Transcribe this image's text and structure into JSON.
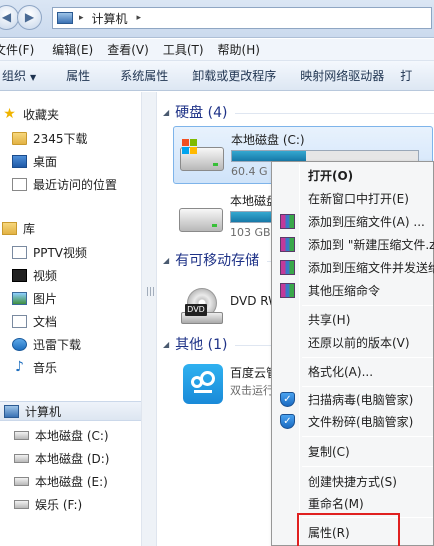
{
  "address": {
    "breadcrumb": "计算机",
    "separator": "▸"
  },
  "menu": [
    "文件(F)",
    "编辑(E)",
    "查看(V)",
    "工具(T)",
    "帮助(H)"
  ],
  "toolbar": {
    "organize": "组织",
    "items": [
      "属性",
      "系统属性",
      "卸载或更改程序",
      "映射网络驱动器",
      "打"
    ]
  },
  "nav": {
    "favorites": "收藏夹",
    "fav_items": [
      "2345下载",
      "桌面",
      "最近访问的位置"
    ],
    "libraries": "库",
    "lib_items": [
      "PPTV视频",
      "视频",
      "图片",
      "文档",
      "迅雷下载",
      "音乐"
    ],
    "computer": "计算机",
    "drives": [
      "本地磁盘 (C:)",
      "本地磁盘 (D:)",
      "本地磁盘 (E:)",
      "娱乐 (F:)"
    ]
  },
  "content": {
    "group_hdd": "硬盘 (4)",
    "group_removable": "有可移动存储",
    "group_other": "其他 (1)",
    "drive_c": {
      "name": "本地磁盘 (C:)",
      "free": "60.4 G",
      "usage": 0.4
    },
    "drive_d": {
      "name": "本地磁盘",
      "free": "103 GB",
      "usage": 0.22
    },
    "dvd": {
      "name": "DVD RW",
      "label": "DVD"
    },
    "cloud": {
      "name": "百度云管",
      "sub": "双击运行"
    }
  },
  "context_menu": {
    "open": "打开(O)",
    "open_new_window": "在新窗口中打开(E)",
    "add_archive": "添加到压缩文件(A) ...",
    "add_named_archive": "添加到 \"新建压缩文件.zi",
    "add_and_send": "添加到压缩文件并发送给",
    "other_compress": "其他压缩命令",
    "share": "共享(H)",
    "restore": "还原以前的版本(V)",
    "format": "格式化(A)...",
    "scan_virus": "扫描病毒(电脑管家)",
    "shred": "文件粉碎(电脑管家)",
    "copy": "复制(C)",
    "create_shortcut": "创建快捷方式(S)",
    "rename": "重命名(M)",
    "properties": "属性(R)"
  },
  "colors": {
    "group_header": "#1e3287",
    "selection": "#cfe3f9",
    "usage_bar": "#1679a8",
    "highlight": "#e02020"
  }
}
